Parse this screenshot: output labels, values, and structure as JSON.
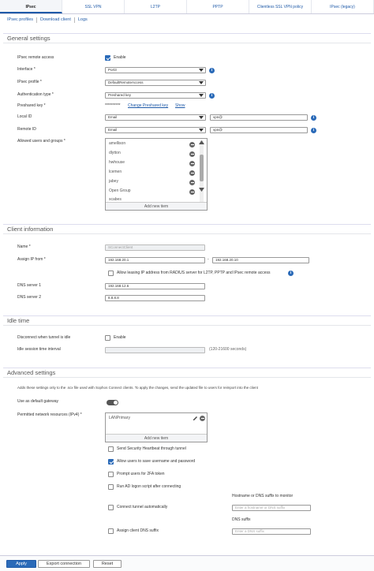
{
  "tabs": [
    {
      "label": "IPsec",
      "active": true
    },
    {
      "label": "SSL VPN"
    },
    {
      "label": "L2TP"
    },
    {
      "label": "PPTP"
    },
    {
      "label": "Clientless SSL VPN policy"
    },
    {
      "label": "IPsec (legacy)"
    }
  ],
  "subtabs": [
    "IPsec profiles",
    "Download client",
    "Logs"
  ],
  "general": {
    "title": "General settings",
    "remote_access_label": "IPsec remote access",
    "enable_label": "Enable",
    "interface_label": "Interface *",
    "interface_value": "Port3",
    "profile_label": "IPsec profile *",
    "profile_value": "DefaultRemoteAccess",
    "auth_type_label": "Authentication type *",
    "auth_type_value": "Preshared key",
    "psk_label": "Preshared key *",
    "psk_value": "**********",
    "psk_change": "Change Preshared key",
    "psk_show": "Show",
    "local_id_label": "Local ID",
    "local_id_type": "Email",
    "local_id_value": "vpn@",
    "remote_id_label": "Remote ID",
    "remote_id_type": "Email",
    "remote_id_value": "vpn@",
    "users_label": "Allowed users and groups *",
    "users": [
      "amellison",
      "dlytton",
      "hwhouse",
      "lcemen",
      "jabey",
      "Open Group",
      "scabes"
    ],
    "add_new": "Add new item"
  },
  "client": {
    "title": "Client information",
    "name_label": "Name *",
    "name_value": "SConnectClient",
    "assign_label": "Assign IP from *",
    "ip_from": "192.168.20.1",
    "ip_sep": "-",
    "ip_to": "192.168.20.10",
    "lease_label": "Allow leasing IP address from RADIUS server for L2TP, PPTP and IPsec remote access",
    "dns1_label": "DNS server 1",
    "dns1_value": "192.168.12.6",
    "dns2_label": "DNS server 2",
    "dns2_value": "8.8.8.8"
  },
  "idle": {
    "title": "Idle time",
    "disconnect_label": "Disconnect when tunnel is idle",
    "enable_label": "Enable",
    "timeout_label": "Idle session time interval",
    "timeout_hint": "(120-21600 seconds)"
  },
  "advanced": {
    "title": "Advanced settings",
    "note": "Adds these settings only to the .scx file used with Sophos Connect clients. To apply the changes, send the updated file to users for reimport into the client",
    "default_gateway_label": "Use as default gateway",
    "networks_label": "Permitted network resources (IPv4) *",
    "networks": [
      "LANPrimary"
    ],
    "add_new": "Add new item",
    "options": [
      {
        "label": "Send Security Heartbeat through tunnel",
        "checked": false
      },
      {
        "label": "Allow users to save username and password",
        "checked": true
      },
      {
        "label": "Prompt users for 2FA token",
        "checked": false
      },
      {
        "label": "Run AD logon script after connecting",
        "checked": false
      },
      {
        "label": "Connect tunnel automatically",
        "checked": false
      },
      {
        "label": "Assign client DNS suffix",
        "checked": false
      }
    ],
    "hostname_label": "Hostname or DNS suffix to monitor",
    "hostname_placeholder": "Enter a hostname or DNS suffix",
    "dns_suffix_label": "DNS suffix",
    "dns_suffix_placeholder": "Enter a DNS suffix"
  },
  "footer": {
    "apply": "Apply",
    "export": "Export connection",
    "reset": "Reset"
  }
}
